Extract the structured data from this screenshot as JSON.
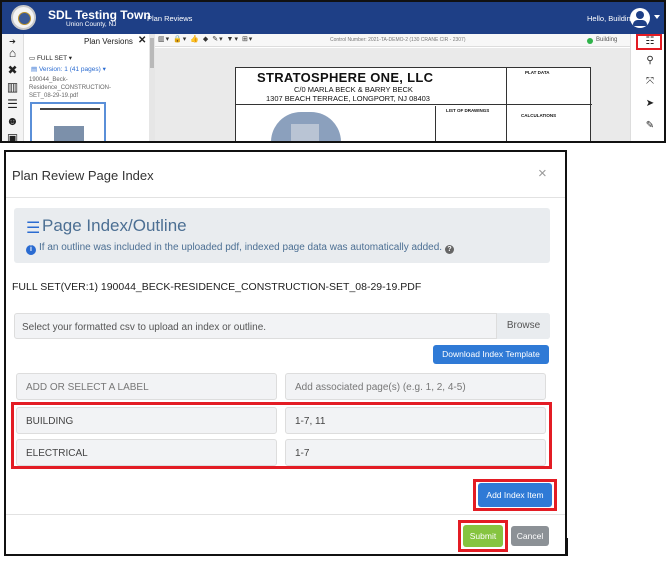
{
  "app": {
    "town_name": "SDL Testing Town",
    "county": "Union County, NJ",
    "nav_link": "Plan Reviews",
    "greeting": "Hello, Building",
    "panel": {
      "title": "Plan Versions",
      "close": "✕",
      "set_label": "FULL SET",
      "version": "Version: 1",
      "version_pages": "(41 pages)",
      "file_name": "190044_Beck-Residence_CONSTRUCTION-SET_08-29-19.pdf"
    },
    "toolbar": {
      "control_number": "Control Number: 2021-TA-DEMO-2 (130 CRANE CIR - 2307)",
      "status": "Building"
    },
    "sheet": {
      "title": "STRATOSPHERE ONE, LLC",
      "line1": "C/0 MARLA BECK & BARRY BECK",
      "line2": "1307 BEACH TERRACE, LONGPORT, NJ 08403",
      "plat_label": "PLAT DATA",
      "calc_label": "CALCULATIONS",
      "drawings_label": "LIST OF DRAWINGS"
    },
    "icons": [
      "home-icon",
      "tools-icon",
      "book-icon",
      "list-icon",
      "users-icon",
      "image-icon"
    ],
    "right_tools": [
      "list-outline-icon",
      "search-icon",
      "expand-icon",
      "pointer-icon",
      "pencil-icon"
    ]
  },
  "modal": {
    "title": "Plan Review Page Index",
    "close": "×",
    "info": {
      "heading": "Page Index/Outline",
      "text": "If an outline was included in the uploaded pdf, indexed page data was automatically added."
    },
    "full_set": "FULL SET(VER:1) 190044_BECK-RESIDENCE_CONSTRUCTION-SET_08-29-19.PDF",
    "upload": {
      "placeholder": "Select your formatted csv to upload an index or outline.",
      "browse": "Browse"
    },
    "download_button": "Download Index Template",
    "label_select_placeholder": "ADD OR SELECT A LABEL",
    "pages_placeholder": "Add associated page(s) (e.g. 1, 2, 4-5)",
    "rows": [
      {
        "label": "BUILDING",
        "pages": "1-7, 11"
      },
      {
        "label": "ELECTRICAL",
        "pages": "1-7"
      }
    ],
    "add_button": "Add Index Item",
    "submit": "Submit",
    "cancel": "Cancel"
  },
  "colors": {
    "navbar": "#1e3f86",
    "primary_button": "#2f7ad6",
    "submit_button": "#86c440",
    "cancel_button": "#8c9196",
    "highlight": "#e31c24"
  }
}
